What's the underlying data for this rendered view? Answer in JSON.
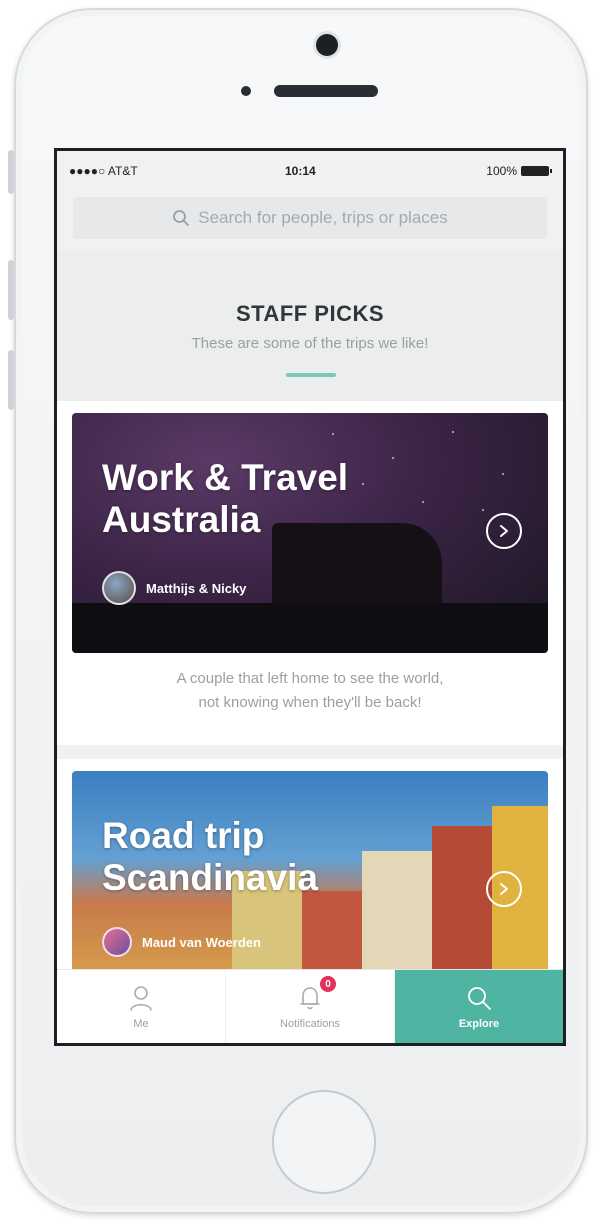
{
  "status_bar": {
    "carrier": "●●●●○ AT&T",
    "time": "10:14",
    "battery": "100%"
  },
  "search": {
    "placeholder": "Search for people, trips or places"
  },
  "staff_picks": {
    "title": "STAFF PICKS",
    "subtitle": "These are some of the trips we like!"
  },
  "cards": [
    {
      "title_line1": "Work & Travel",
      "title_line2": "Australia",
      "author": "Matthijs & Nicky",
      "description_line1": "A couple that left home to see the world,",
      "description_line2": "not knowing when they'll be back!"
    },
    {
      "title_line1": "Road trip",
      "title_line2": "Scandinavia",
      "author": "Maud van Woerden"
    }
  ],
  "tabbar": {
    "items": [
      {
        "label": "Me",
        "icon": "person-icon"
      },
      {
        "label": "Notifications",
        "icon": "bell-icon",
        "badge": "0"
      },
      {
        "label": "Explore",
        "icon": "search-icon"
      }
    ],
    "active": "Explore"
  },
  "colors": {
    "accent": "#4fb4a1",
    "badge": "#e0335b"
  }
}
